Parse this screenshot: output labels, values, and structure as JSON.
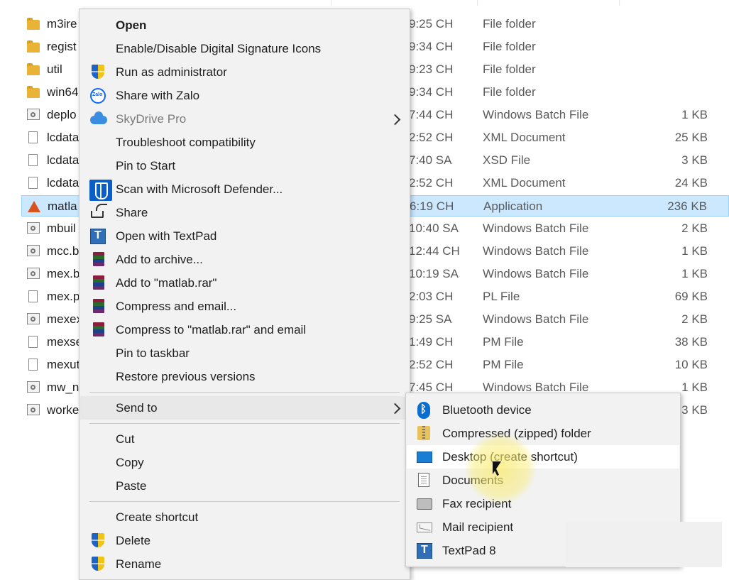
{
  "files": [
    {
      "icon": "folder",
      "name": "m3ire",
      "time": "9:25 CH",
      "type": "File folder",
      "size": ""
    },
    {
      "icon": "folder",
      "name": "regist",
      "time": "9:34 CH",
      "type": "File folder",
      "size": ""
    },
    {
      "icon": "folder",
      "name": "util",
      "time": "9:23 CH",
      "type": "File folder",
      "size": ""
    },
    {
      "icon": "folder",
      "name": "win64",
      "time": "9:34 CH",
      "type": "File folder",
      "size": ""
    },
    {
      "icon": "bat",
      "name": "deplo",
      "time": "7:44 CH",
      "type": "Windows Batch File",
      "size": "1 KB"
    },
    {
      "icon": "doc",
      "name": "lcdata",
      "time": "2:52 CH",
      "type": "XML Document",
      "size": "25 KB"
    },
    {
      "icon": "doc",
      "name": "lcdata",
      "time": "7:40 SA",
      "type": "XSD File",
      "size": "3 KB"
    },
    {
      "icon": "doc",
      "name": "lcdata",
      "time": "2:52 CH",
      "type": "XML Document",
      "size": "24 KB"
    },
    {
      "icon": "app",
      "name": "matla",
      "time": "6:19 CH",
      "type": "Application",
      "size": "236 KB",
      "selected": true
    },
    {
      "icon": "bat",
      "name": "mbuil",
      "time": "10:40 SA",
      "type": "Windows Batch File",
      "size": "2 KB"
    },
    {
      "icon": "bat",
      "name": "mcc.b",
      "time": "12:44 CH",
      "type": "Windows Batch File",
      "size": "1 KB"
    },
    {
      "icon": "bat",
      "name": "mex.b",
      "time": "10:19 SA",
      "type": "Windows Batch File",
      "size": "1 KB"
    },
    {
      "icon": "doc",
      "name": "mex.p",
      "time": "2:03 CH",
      "type": "PL File",
      "size": "69 KB"
    },
    {
      "icon": "bat",
      "name": "mexex",
      "time": "9:25 SA",
      "type": "Windows Batch File",
      "size": "2 KB"
    },
    {
      "icon": "doc",
      "name": "mexse",
      "time": "1:49 CH",
      "type": "PM File",
      "size": "38 KB"
    },
    {
      "icon": "doc",
      "name": "mexut",
      "time": "2:52 CH",
      "type": "PM File",
      "size": "10 KB"
    },
    {
      "icon": "bat",
      "name": "mw_n",
      "time": "7:45 CH",
      "type": "Windows Batch File",
      "size": "1 KB"
    },
    {
      "icon": "bat",
      "name": "worke",
      "time": "",
      "type": "",
      "size": "3 KB"
    }
  ],
  "context_menu": {
    "items": [
      {
        "id": "open",
        "label": "Open",
        "bold": true
      },
      {
        "id": "digital-signature",
        "label": "Enable/Disable Digital Signature Icons"
      },
      {
        "id": "run-as-admin",
        "label": "Run as administrator",
        "icon": "shield"
      },
      {
        "id": "share-zalo",
        "label": "Share with Zalo",
        "icon": "zalo"
      },
      {
        "id": "skydrive-pro",
        "label": "SkyDrive Pro",
        "icon": "cloud",
        "disabled": true,
        "submenu": true
      },
      {
        "id": "troubleshoot",
        "label": "Troubleshoot compatibility"
      },
      {
        "id": "pin-start",
        "label": "Pin to Start"
      },
      {
        "id": "scan-defender",
        "label": "Scan with Microsoft Defender...",
        "icon": "defender"
      },
      {
        "id": "share",
        "label": "Share",
        "icon": "share"
      },
      {
        "id": "open-textpad",
        "label": "Open with TextPad",
        "icon": "textpad"
      },
      {
        "id": "add-archive",
        "label": "Add to archive...",
        "icon": "rar"
      },
      {
        "id": "add-matlab-rar",
        "label": "Add to \"matlab.rar\"",
        "icon": "rar"
      },
      {
        "id": "compress-email",
        "label": "Compress and email...",
        "icon": "rar"
      },
      {
        "id": "compress-matlab-email",
        "label": "Compress to \"matlab.rar\" and email",
        "icon": "rar"
      },
      {
        "id": "pin-taskbar",
        "label": "Pin to taskbar"
      },
      {
        "id": "restore-versions",
        "label": "Restore previous versions"
      },
      {
        "sep": true
      },
      {
        "id": "send-to",
        "label": "Send to",
        "submenu": true,
        "active": true
      },
      {
        "sep": true
      },
      {
        "id": "cut",
        "label": "Cut"
      },
      {
        "id": "copy",
        "label": "Copy"
      },
      {
        "id": "paste",
        "label": "Paste"
      },
      {
        "sep": true
      },
      {
        "id": "create-shortcut",
        "label": "Create shortcut"
      },
      {
        "id": "delete",
        "label": "Delete",
        "icon": "shield"
      },
      {
        "id": "rename",
        "label": "Rename",
        "icon": "shield"
      }
    ]
  },
  "sendto_menu": {
    "items": [
      {
        "id": "bluetooth",
        "label": "Bluetooth device",
        "icon": "bluetooth"
      },
      {
        "id": "compressed-folder",
        "label": "Compressed (zipped) folder",
        "icon": "zip"
      },
      {
        "id": "desktop-shortcut",
        "label": "Desktop (create shortcut)",
        "icon": "desktop",
        "highlight": true
      },
      {
        "id": "documents",
        "label": "Documents",
        "icon": "documents"
      },
      {
        "id": "fax",
        "label": "Fax recipient",
        "icon": "fax"
      },
      {
        "id": "mail",
        "label": "Mail recipient",
        "icon": "mail"
      },
      {
        "id": "textpad8",
        "label": "TextPad 8",
        "icon": "textpad"
      }
    ]
  }
}
